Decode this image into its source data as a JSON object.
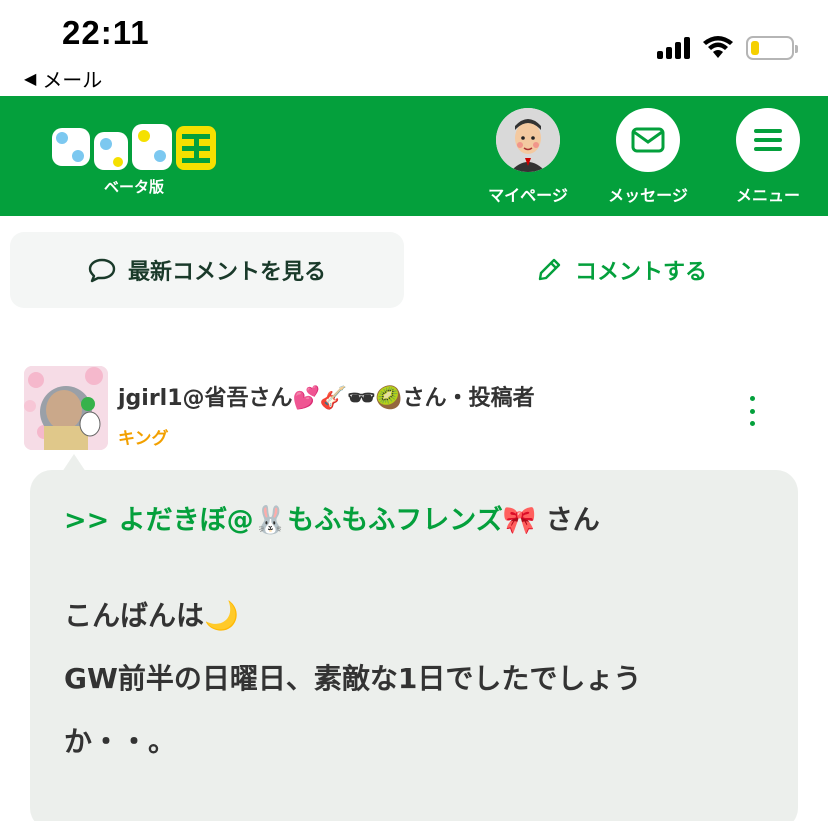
{
  "status_bar": {
    "time": "22:11",
    "back_label": "メール",
    "back_icon": "back-triangle-icon",
    "battery_color": "#f5d000",
    "battery_level": 0.2
  },
  "header": {
    "logo_text": "マイネ王",
    "logo_sub": "ベータ版",
    "brand_color": "#04a03c",
    "nav": [
      {
        "label": "マイページ",
        "icon": "user-avatar-icon"
      },
      {
        "label": "メッセージ",
        "icon": "envelope-icon"
      },
      {
        "label": "メニュー",
        "icon": "hamburger-icon"
      }
    ]
  },
  "tabs": {
    "latest": {
      "label": "最新コメントを見る",
      "icon": "speech-bubble-icon"
    },
    "post": {
      "label": "コメントする",
      "icon": "pencil-icon"
    }
  },
  "comment": {
    "user_name": "jgirl1@省吾さん💕🎸🕶🥝さん・投稿者",
    "rank": "キング",
    "rank_color": "#f2a000",
    "reply_target": ">> よだきぼ@🐰もふもふフレンズ🎀",
    "reply_suffix": " さん",
    "body_lines": [
      "こんばんは🌙",
      "GW前半の日曜日、素敵な1日でしたでしょう",
      "か・・。"
    ]
  }
}
